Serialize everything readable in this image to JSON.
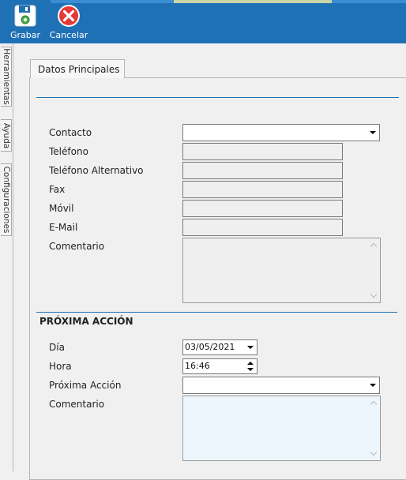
{
  "toolbar": {
    "save_label": "Grabar",
    "cancel_label": "Cancelar",
    "accent_color": "#1f71b6"
  },
  "side_tabs": [
    {
      "label": "Herramientas"
    },
    {
      "label": "Ayuda"
    },
    {
      "label": "Configuraciones"
    }
  ],
  "main_tab": {
    "label": "Datos Principales"
  },
  "form": {
    "contacto_label": "Contacto",
    "contacto_value": "",
    "telefono_label": "Teléfono",
    "telefono_alt_label": "Teléfono Alternativo",
    "fax_label": "Fax",
    "movil_label": "Móvil",
    "email_label": "E-Mail",
    "comentario_label": "Comentario"
  },
  "next_action": {
    "section_title": "PRÓXIMA ACCIÓN",
    "dia_label": "Día",
    "dia_value": "03/05/2021",
    "hora_label": "Hora",
    "hora_value": "16:46",
    "proxima_label": "Próxima Acción",
    "proxima_value": "",
    "comentario_label": "Comentario"
  },
  "icons": {
    "save": "floppy-disk-icon",
    "cancel": "cancel-x-icon"
  }
}
